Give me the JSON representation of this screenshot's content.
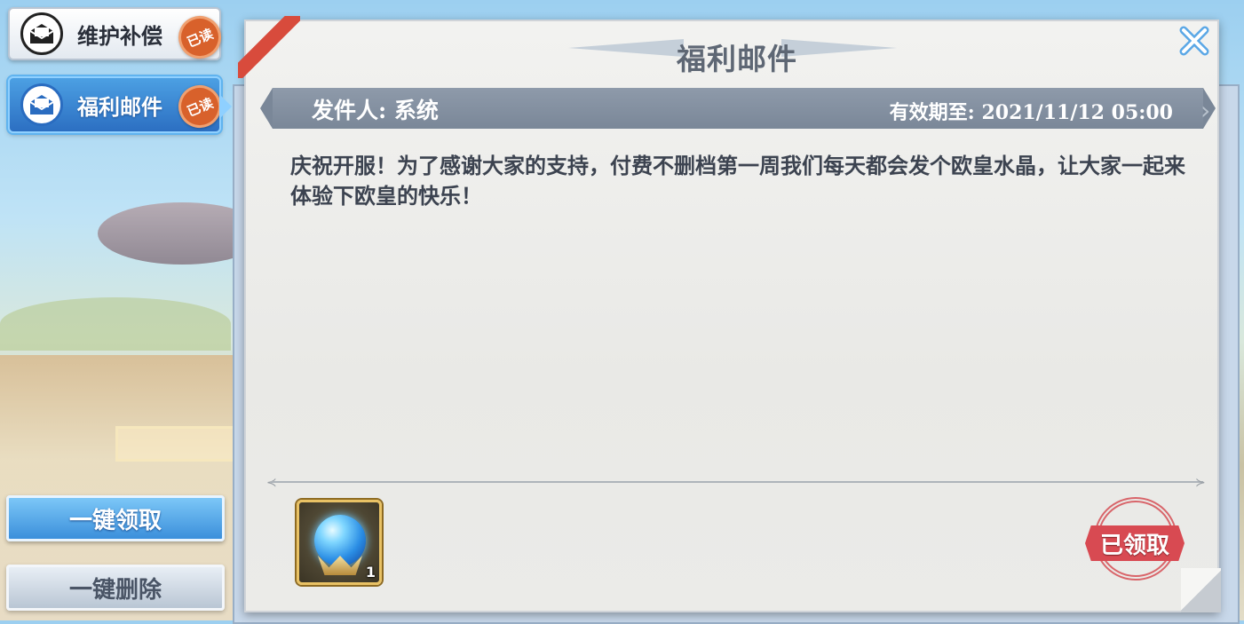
{
  "tabs": [
    {
      "label": "维护补偿",
      "read_badge": "已读",
      "icon": "envelope-open-icon",
      "selected": false
    },
    {
      "label": "福利邮件",
      "read_badge": "已读",
      "icon": "envelope-icon",
      "selected": true
    }
  ],
  "actions": {
    "claim_all": "一键领取",
    "delete_all": "一键删除"
  },
  "mail": {
    "title": "福利邮件",
    "sender": "发件人: 系统",
    "expiry": "有效期至: 2021/11/12 05:00",
    "body": "庆祝开服！为了感谢大家的支持，付费不删档第一周我们每天都会发个欧皇水晶，让大家一起来体验下欧皇的快乐！",
    "attachments": [
      {
        "name": "crystal-orb-icon",
        "count": "1"
      }
    ],
    "status_stamp": "已领取"
  },
  "colors": {
    "selected_tab": "#3b8fdb",
    "badge": "#d8612b",
    "stamp": "#d84a52",
    "sender_bar": "#8e9aaa"
  }
}
